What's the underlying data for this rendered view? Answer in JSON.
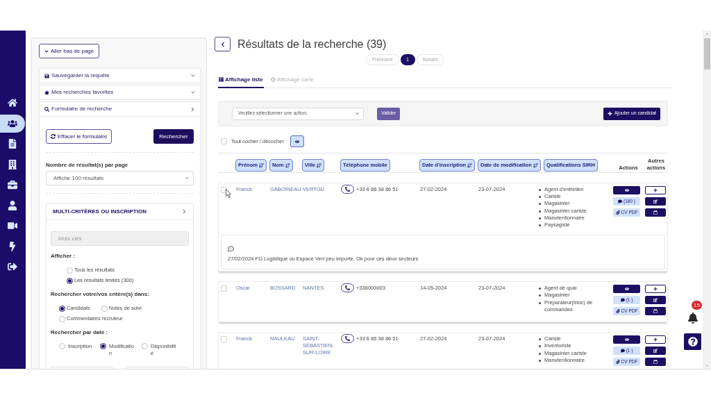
{
  "nav": [
    {
      "kind": "home",
      "selected": false
    },
    {
      "kind": "candidates",
      "selected": true
    },
    {
      "kind": "documents",
      "selected": false
    },
    {
      "kind": "companies",
      "selected": false
    },
    {
      "kind": "jobs",
      "selected": false
    },
    {
      "kind": "profile",
      "selected": false
    },
    {
      "kind": "video",
      "selected": false
    },
    {
      "kind": "quick",
      "selected": false
    },
    {
      "kind": "logout",
      "selected": false
    }
  ],
  "search_panel": {
    "jump_button": "Aller bas de page",
    "sections": [
      {
        "kind": "save",
        "label": "Sauvegarder la requête",
        "expanded": false
      },
      {
        "kind": "favorites",
        "label": "Mes recherches favorites",
        "expanded": false
      },
      {
        "kind": "search",
        "label": "Formulaire de recherche",
        "expanded": true
      }
    ],
    "clear_button": "Effacer le formulaire",
    "search_button": "Rechercher",
    "per_page": {
      "label": "Nombre de résultat(s) par page",
      "value": "Affiche 100 résultats"
    },
    "criteria": {
      "title": "MULTI-CRITÈRES OU INSCRIPTION",
      "expanded": true,
      "keywords": {
        "placeholder": "Mots clés"
      },
      "groups": [
        {
          "kind": "stacked",
          "label": "Afficher :",
          "options": [
            {
              "label": "Tous les résultats",
              "selected": false
            },
            {
              "label": "Les résultats limités (300)",
              "selected": true
            }
          ]
        },
        {
          "kind": "inline",
          "label": "Rechercher votre/vos critère(s) dans:",
          "options": [
            {
              "label": "Candidats",
              "selected": true
            },
            {
              "label": "Notes de suivi",
              "selected": false
            },
            {
              "label": "Commentaires recruteur",
              "selected": false
            }
          ]
        },
        {
          "kind": "columns",
          "label": "Rechercher par date :",
          "options": [
            {
              "label": "Inscription",
              "selected": false
            },
            {
              "label": "Modification",
              "selected": true
            },
            {
              "label": "Disponibilité",
              "selected": false
            }
          ]
        }
      ]
    }
  },
  "results": {
    "title": "Résultats de la recherche (39)",
    "pagination": {
      "previous": {
        "label": "Précédent",
        "disabled": true
      },
      "pages": [
        {
          "label": "1",
          "selected": true
        }
      ],
      "next": {
        "label": "Suivant",
        "disabled": true
      }
    },
    "tabs": [
      {
        "kind": "list",
        "label": "Affichage liste",
        "selected": true
      },
      {
        "kind": "map",
        "label": "Affichage carte",
        "selected": false
      }
    ],
    "action_bar": {
      "action_select": "Veuillez sélectionner une action.",
      "validate_button": "Valider",
      "add_button": "Ajouter un candidat"
    },
    "select_all": {
      "label": "Tout cocher / décocher",
      "checked": false
    },
    "table": {
      "columns": [
        {
          "kind": "pill",
          "label": "Prénom",
          "sortable": true
        },
        {
          "kind": "pill",
          "label": "Nom",
          "sortable": true
        },
        {
          "kind": "pill",
          "label": "Ville",
          "sortable": true
        },
        {
          "kind": "pill",
          "label": "Téléphone mobile",
          "sortable": false
        },
        {
          "kind": "pill",
          "label": "Date d'inscription",
          "sortable": true
        },
        {
          "kind": "pill",
          "label": "Date de modification",
          "sortable": true
        },
        {
          "kind": "pill",
          "label": "Qualifications SIRH",
          "sortable": false
        },
        {
          "kind": "plain",
          "label": "Actions"
        },
        {
          "kind": "plain",
          "label": "Autres actions"
        }
      ],
      "rows": [
        {
          "checked": false,
          "hovered": true,
          "first_name": "Franck",
          "last_name": "GABORIEAU",
          "city": "VERTOU",
          "phone": "+33 6 86 38 86 51",
          "registered": "27-02-2024",
          "modified": "23-07-2024",
          "qualifications": [
            "Agent d'entretien",
            "Cariste",
            "Magasinier",
            "Magasinier cariste",
            "Manutentionnaire",
            "Paysagiste"
          ],
          "comments": "(160 )",
          "cv": "CV PDF",
          "note": "27/02/2024 FG Logistique ou Espace Vert peu importe. Ok pour ces deux secteurs"
        },
        {
          "checked": false,
          "hovered": false,
          "first_name": "Oscar",
          "last_name": "BOSSARD",
          "city": "NANTES",
          "phone": "+336000003",
          "registered": "14-05-2024",
          "modified": "23-07-2024",
          "qualifications": [
            "Agent de quai",
            "Magasinier",
            "Préparateur(trice) de commandes"
          ],
          "comments": "(1 )",
          "cv": "CV PDF"
        },
        {
          "checked": false,
          "hovered": false,
          "first_name": "Franck",
          "last_name": "NAULEAU",
          "city": "SAINT-SÉBASTIEN-SUR-LOIRE",
          "phone": "+33 6 86 38 86 51",
          "registered": "27-02-2024",
          "modified": "23-07-2024",
          "qualifications": [
            "Cariste",
            "Inventoriste",
            "Magasinier cariste",
            "Manutentionnaire"
          ],
          "comments": "(1 )",
          "cv": "CV PDF"
        }
      ]
    }
  },
  "notifications": {
    "count": "15"
  }
}
